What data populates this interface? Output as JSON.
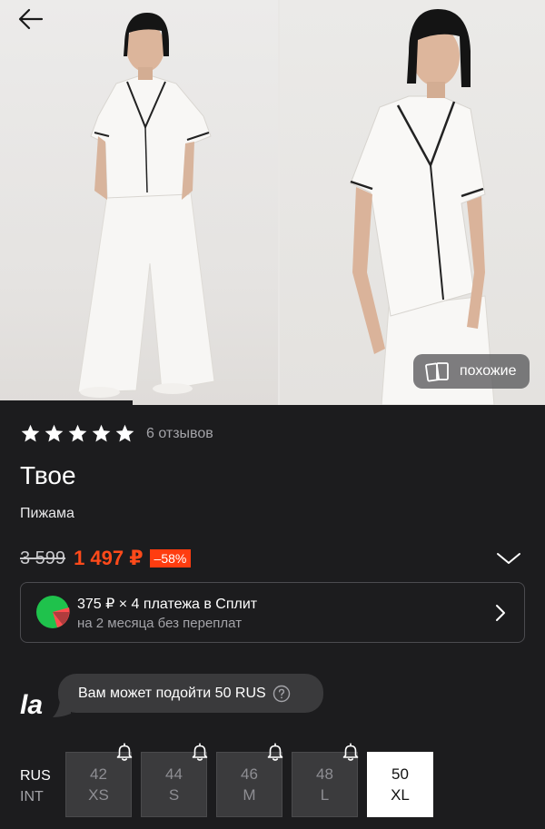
{
  "gallery": {
    "images": [
      "photo-model-full-length",
      "photo-model-closeup"
    ],
    "similar_label": "похожие",
    "back_icon": "arrow-left-icon"
  },
  "rating": {
    "stars": 5,
    "reviews_label": "6 отзывов"
  },
  "product": {
    "brand": "Твое",
    "type": "Пижама"
  },
  "price": {
    "old": "3 599",
    "current": "1 497 ₽",
    "discount": "–58%"
  },
  "split": {
    "title": "375 ₽ × 4 платежа в Сплит",
    "subtitle": "на 2 месяца без переплат"
  },
  "assistant": {
    "logo": "la",
    "message": "Вам может подойти 50 RUS"
  },
  "sizes": {
    "system_primary": "RUS",
    "system_secondary": "INT",
    "items": [
      {
        "rus": "42",
        "int": "XS",
        "available": false,
        "notify": true
      },
      {
        "rus": "44",
        "int": "S",
        "available": false,
        "notify": true
      },
      {
        "rus": "46",
        "int": "M",
        "available": false,
        "notify": true
      },
      {
        "rus": "48",
        "int": "L",
        "available": false,
        "notify": true
      },
      {
        "rus": "50",
        "int": "XL",
        "available": true,
        "notify": false
      }
    ]
  },
  "colors": {
    "background": "#1c1c1e",
    "sale_price": "#ff4a1a",
    "discount_badge": "#ff3d10",
    "muted_text": "#a3a3a8"
  }
}
